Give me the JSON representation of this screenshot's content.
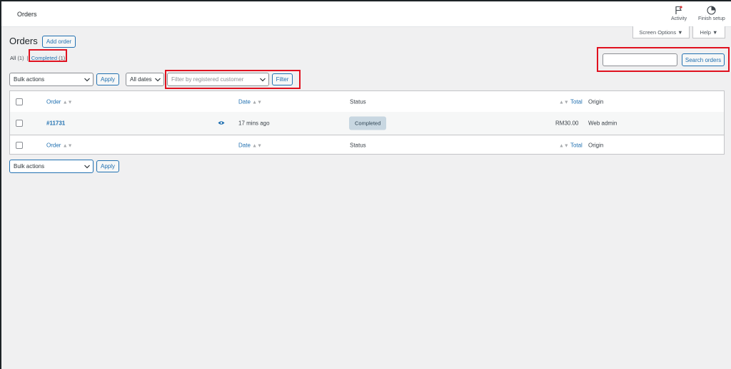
{
  "topbar": {
    "title": "Orders",
    "activity_label": "Activity",
    "finish_setup_label": "Finish setup"
  },
  "screen_options": {
    "screen_options_label": "Screen Options ▼",
    "help_label": "Help ▼"
  },
  "header": {
    "title": "Orders",
    "add_order_label": "Add order"
  },
  "views": {
    "all_label": "All",
    "all_count": "(1)",
    "separator": "|",
    "completed_label": "Completed",
    "completed_count": "(1)"
  },
  "search": {
    "value": "",
    "button_label": "Search orders"
  },
  "filters": {
    "bulk_actions": "Bulk actions",
    "apply_label": "Apply",
    "dates": "All dates",
    "customer_placeholder": "Filter by registered customer",
    "filter_label": "Filter"
  },
  "table": {
    "columns": {
      "order": "Order",
      "date": "Date",
      "status": "Status",
      "total": "Total",
      "origin": "Origin"
    },
    "sort_indicator": "▲▼",
    "rows": [
      {
        "order": "#11731",
        "date": "17 mins ago",
        "status": "Completed",
        "total": "RM30.00",
        "origin": "Web admin"
      }
    ]
  },
  "bottom_actions": {
    "bulk_actions": "Bulk actions",
    "apply_label": "Apply"
  },
  "colors": {
    "accent": "#2271b1",
    "highlight": "#e0111f",
    "status_completed_bg": "#c8d7e1"
  },
  "icons": [
    "flag-icon",
    "progress-circle-icon",
    "chevron-down-icon",
    "eye-icon",
    "sort-icon"
  ]
}
